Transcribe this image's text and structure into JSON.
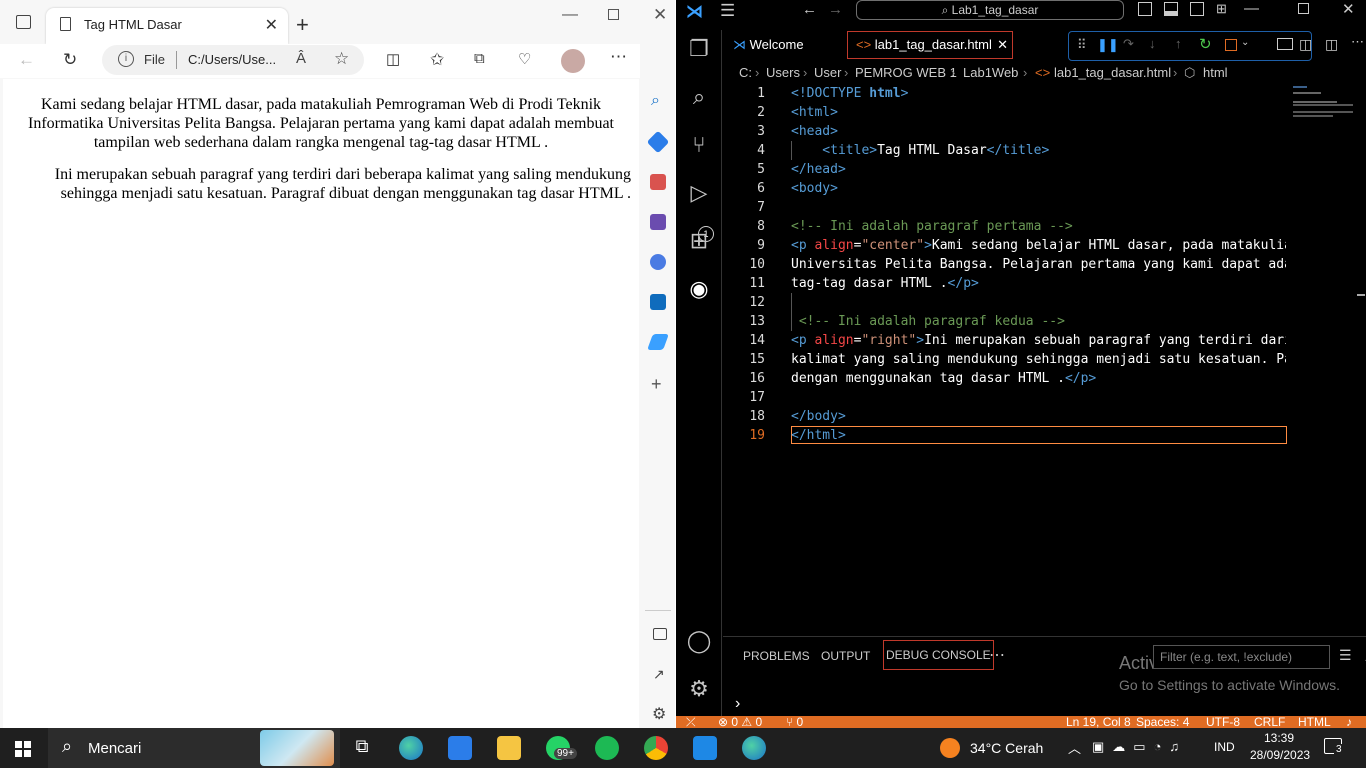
{
  "browser": {
    "tab_title": "Tag HTML Dasar",
    "address_prefix": "File",
    "address_url": "C:/Users/Use...",
    "read_aloud": "Â",
    "content": {
      "p1": "Kami sedang belajar HTML dasar, pada matakuliah Pemrograman Web di Prodi Teknik Informatika Universitas Pelita Bangsa. Pelajaran pertama yang kami dapat adalah membuat tampilan web sederhana dalam rangka mengenal tag-tag dasar HTML .",
      "p2": "Ini merupakan sebuah paragraf yang terdiri dari beberapa kalimat yang saling mendukung sehingga menjadi satu kesatuan. Paragraf dibuat dengan menggunakan tag dasar HTML ."
    }
  },
  "vscode": {
    "command_center": "Lab1_tag_dasar",
    "tabs": [
      {
        "label": "Welcome"
      },
      {
        "label": "lab1_tag_dasar.html"
      }
    ],
    "breadcrumb": [
      "C:",
      "Users",
      "User",
      "PEMROG WEB 1",
      "Lab1Web",
      "lab1_tag_dasar.html",
      "html"
    ],
    "lines": [
      {
        "n": "1"
      },
      {
        "n": "2"
      },
      {
        "n": "3"
      },
      {
        "n": "4"
      },
      {
        "n": "5"
      },
      {
        "n": "6"
      },
      {
        "n": "7"
      },
      {
        "n": "8"
      },
      {
        "n": "9"
      },
      {
        "n": "10"
      },
      {
        "n": "11"
      },
      {
        "n": "12"
      },
      {
        "n": "13"
      },
      {
        "n": "14"
      },
      {
        "n": "15"
      },
      {
        "n": "16"
      },
      {
        "n": "17"
      },
      {
        "n": "18"
      },
      {
        "n": "19"
      }
    ],
    "code": {
      "l1a": "<!DOCTYPE ",
      "l1b": "html",
      "l1c": ">",
      "l2": "<html>",
      "l3": "<head>",
      "l4a": "    <title>",
      "l4b": "Tag HTML Dasar",
      "l4c": "</title>",
      "l5": "</head>",
      "l6": "<body>",
      "l8": "<!-- Ini adalah paragraf pertama -->",
      "l9a": "<p ",
      "l9b": "align",
      "l9c": "=",
      "l9d": "\"center\"",
      "l9e": ">",
      "l9f": "Kami sedang belajar HTML dasar, pada matakuliah",
      "l10": "Universitas Pelita Bangsa. Pelajaran pertama yang kami dapat adalah",
      "l11a": "tag-tag dasar HTML .",
      "l11b": "</p>",
      "l13": " <!-- Ini adalah paragraf kedua -->",
      "l14a": "<p ",
      "l14b": "align",
      "l14c": "=",
      "l14d": "\"right\"",
      "l14e": ">",
      "l14f": "Ini merupakan sebuah paragraf yang terdiri dari",
      "l15": "kalimat yang saling mendukung sehingga menjadi satu kesatuan. Parag",
      "l16a": "dengan menggunakan tag dasar HTML .",
      "l16b": "</p>",
      "l18": "</body>",
      "l19": "</html>"
    },
    "panel": {
      "tabs": [
        "PROBLEMS",
        "OUTPUT",
        "DEBUG CONSOLE"
      ],
      "filter_placeholder": "Filter (e.g. text, !exclude)",
      "activate_title": "Activate Windows",
      "activate_sub": "Go to Settings to activate Windows."
    },
    "status": {
      "errors": "⊗ 0 ⚠ 0",
      "ports": "⑂ 0",
      "position": "Ln 19, Col 8",
      "spaces": "Spaces: 4",
      "encoding": "UTF-8",
      "eol": "CRLF",
      "language": "HTML"
    },
    "debug_badge": "1"
  },
  "taskbar": {
    "search_label": "Mencari",
    "whatsapp_badge": "99+",
    "weather": "34°C  Cerah",
    "lang": "IND",
    "time": "13:39",
    "date": "28/09/2023",
    "notif_count": "3"
  },
  "colors": {
    "vscode_accent": "#e06c23",
    "debug_border": "#1e5fa8",
    "edge_blue": "#1a73c8"
  }
}
